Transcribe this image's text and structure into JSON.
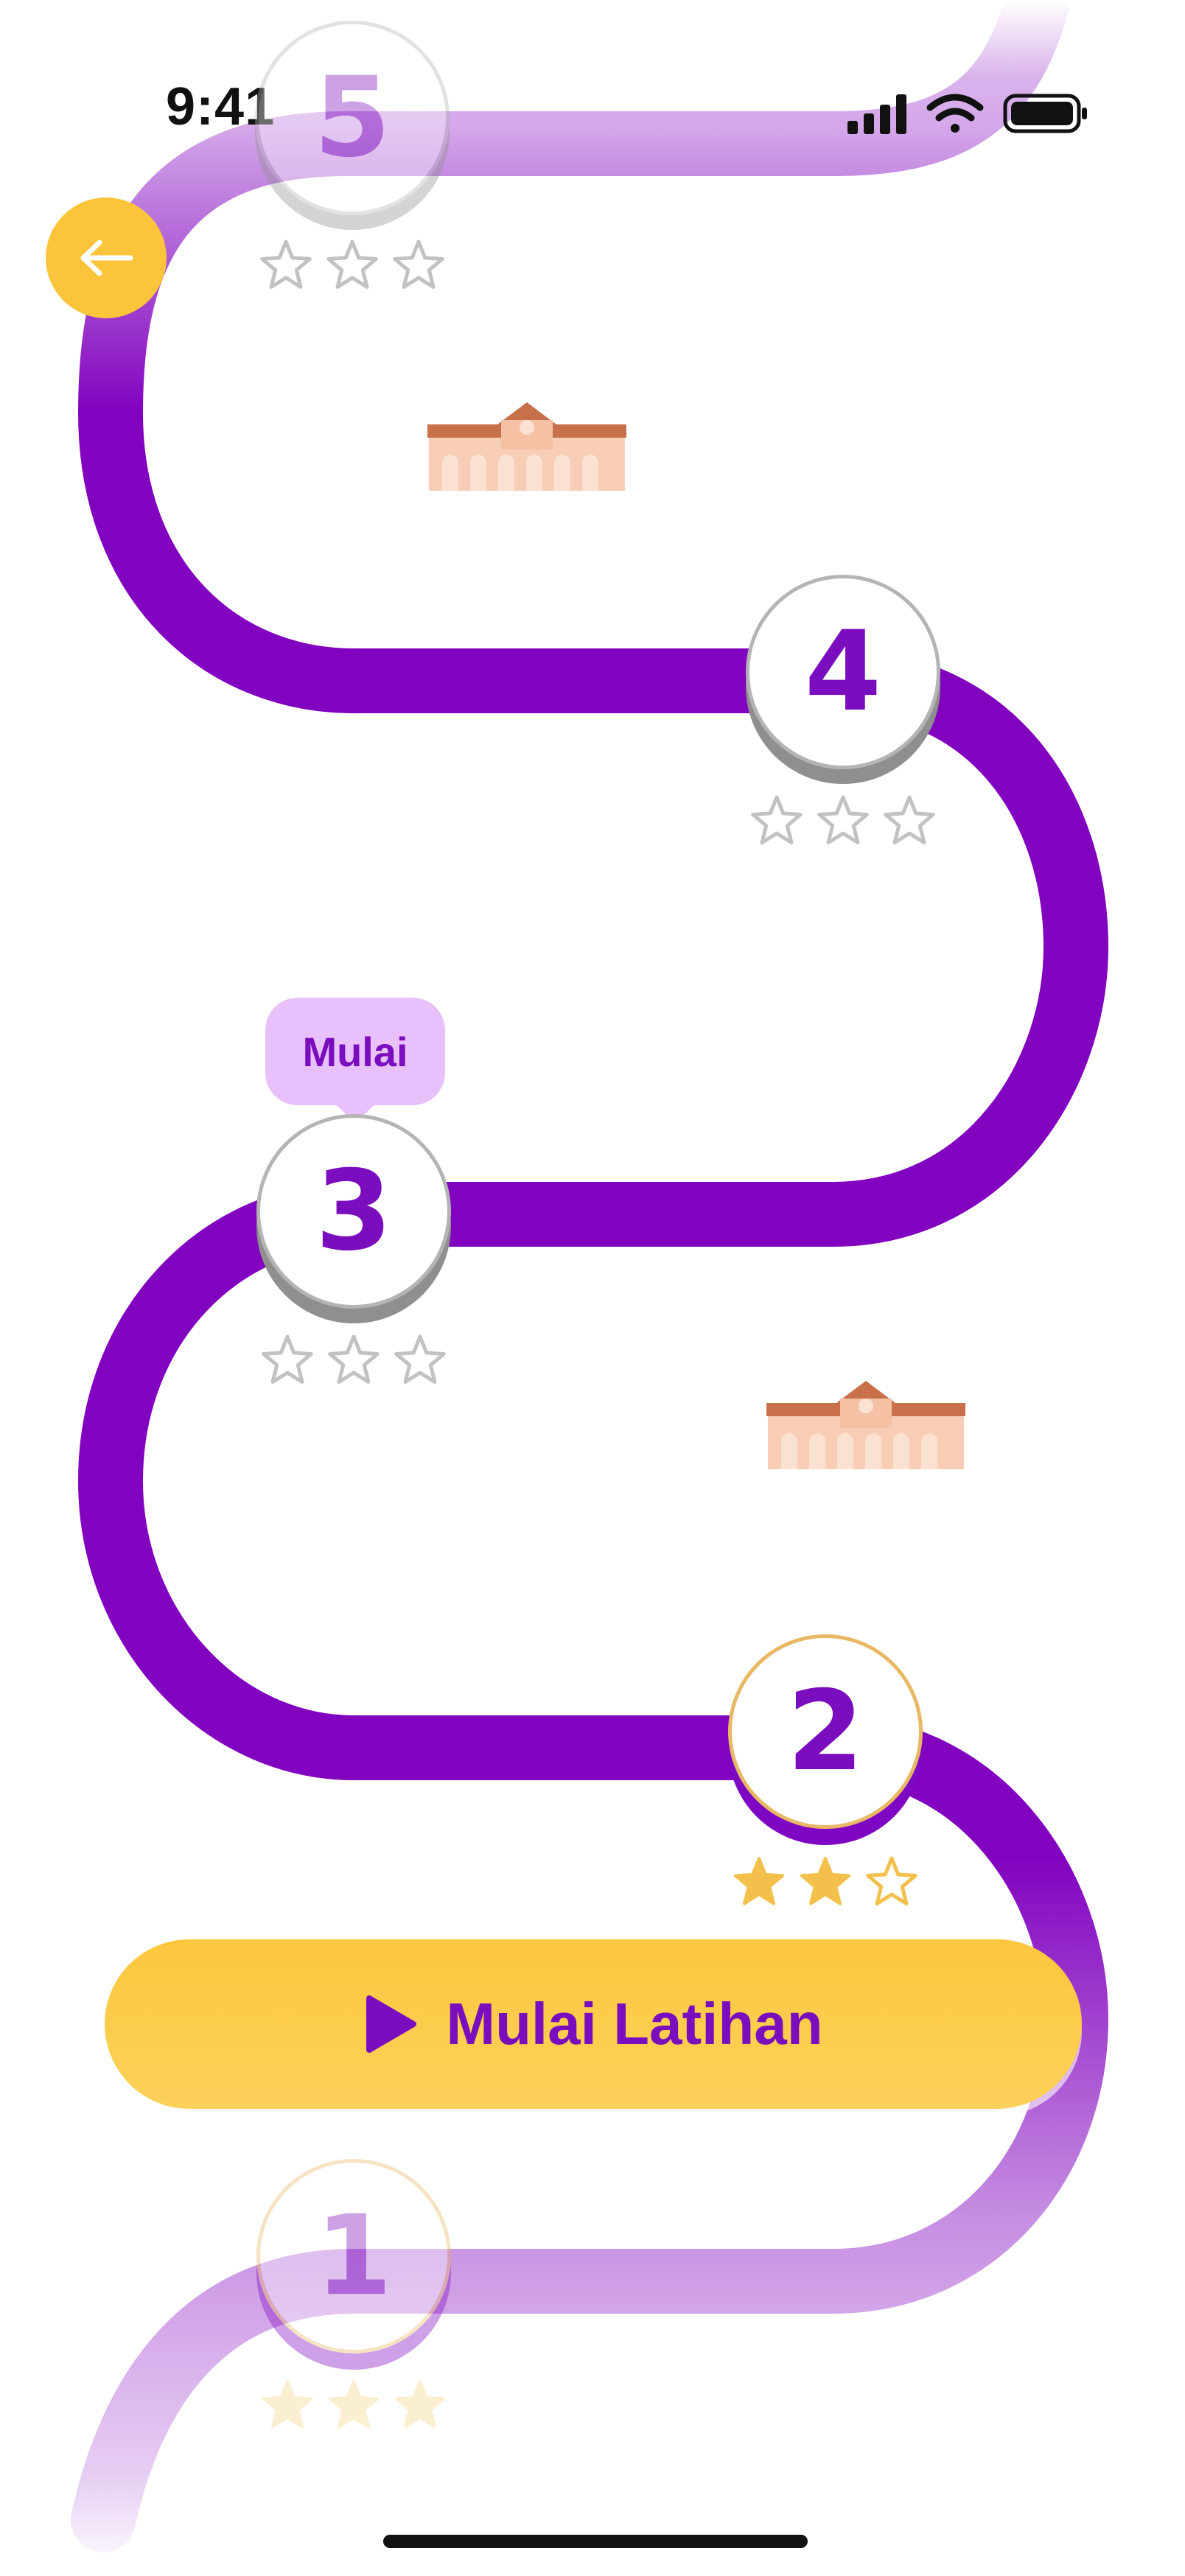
{
  "status_bar": {
    "time": "9:41"
  },
  "back_button": {
    "icon": "arrow-left-icon"
  },
  "levels": [
    {
      "number": "1",
      "stars_earned": 3,
      "state": "completed"
    },
    {
      "number": "2",
      "stars_earned": 2,
      "state": "completed"
    },
    {
      "number": "3",
      "stars_earned": 0,
      "state": "current"
    },
    {
      "number": "4",
      "stars_earned": 0,
      "state": "locked"
    },
    {
      "number": "5",
      "stars_earned": 0,
      "state": "locked"
    }
  ],
  "tooltip": {
    "label": "Mulai"
  },
  "cta": {
    "label": "Mulai Latihan",
    "icon": "play-icon"
  },
  "colors": {
    "path": "#8102bf",
    "accent_yellow": "#fbc43a",
    "star_filled": "#f3c14b",
    "star_empty": "#c2c2c2",
    "tooltip_bg": "#e8c0fb",
    "text_primary": "#7a0dbd"
  },
  "decorations": [
    "building-icon",
    "building-icon"
  ]
}
